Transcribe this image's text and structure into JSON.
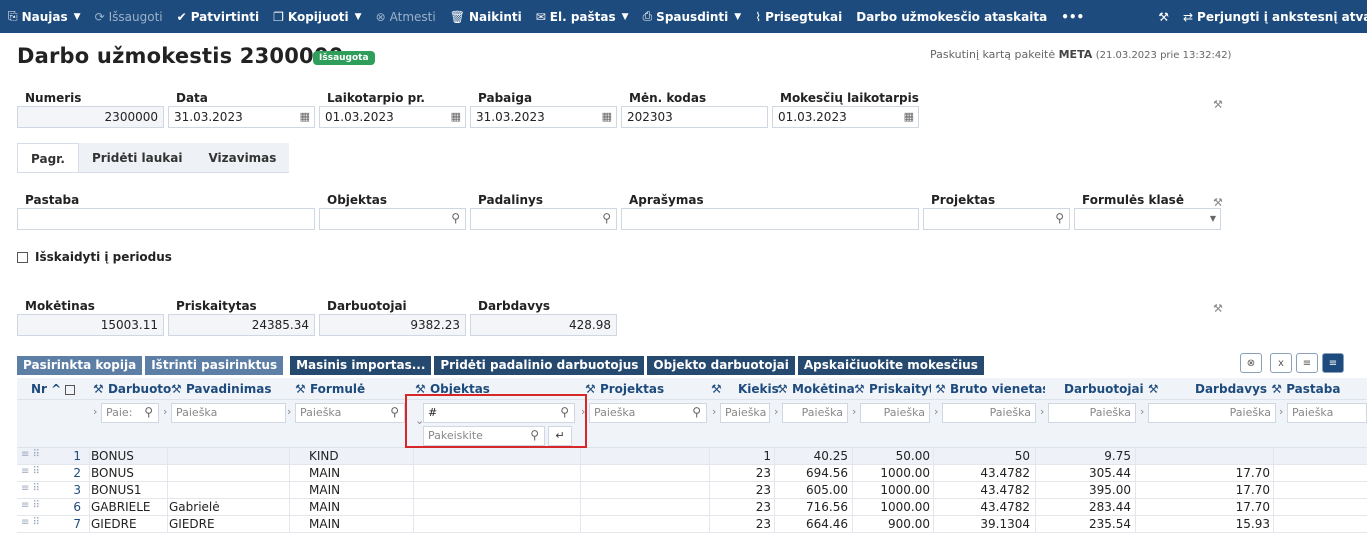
{
  "toolbar": {
    "items": [
      {
        "icon": "new-doc-icon",
        "label": "Naujas",
        "caret": true,
        "dim": false
      },
      {
        "icon": "save-icon",
        "label": "Išsaugoti",
        "caret": false,
        "dim": true
      },
      {
        "icon": "check-icon",
        "label": "Patvirtinti",
        "caret": false,
        "dim": false
      },
      {
        "icon": "copy-icon",
        "label": "Kopijuoti",
        "caret": true,
        "dim": false
      },
      {
        "icon": "cancel-icon",
        "label": "Atmesti",
        "caret": false,
        "dim": true
      },
      {
        "icon": "trash-icon",
        "label": "Naikinti",
        "caret": false,
        "dim": false
      },
      {
        "icon": "mail-icon",
        "label": "El. paštas",
        "caret": true,
        "dim": false
      },
      {
        "icon": "print-icon",
        "label": "Spausdinti",
        "caret": true,
        "dim": false
      },
      {
        "icon": "paperclip-icon",
        "label": "Prisegtukai",
        "caret": false,
        "dim": false
      },
      {
        "icon": "",
        "label": "Darbo užmokesčio ataskaita",
        "caret": false,
        "dim": false
      },
      {
        "icon": "",
        "label": "•••",
        "caret": false,
        "dim": false
      }
    ],
    "switch_label": "Perjungti į ankstesnį atvaizdavimą"
  },
  "header": {
    "title": "Darbo užmokestis 2300000",
    "status": "Išsaugota",
    "last_changed_prefix": "Paskutinį kartą pakeitė",
    "last_changed_user": "META",
    "last_changed_time": "(21.03.2023 prie 13:32:42)"
  },
  "fields": {
    "numeris_label": "Numeris",
    "numeris": "2300000",
    "data_label": "Data",
    "data": "31.03.2023",
    "laikotarpio_label": "Laikotarpio pr.",
    "laikotarpio": "01.03.2023",
    "pabaiga_label": "Pabaiga",
    "pabaiga": "31.03.2023",
    "men_kodas_label": "Mėn. kodas",
    "men_kodas": "202303",
    "mokesciu_label": "Mokesčių laikotarpis",
    "mokesciu": "01.03.2023"
  },
  "tabs": [
    "Pagr.",
    "Pridėti laukai",
    "Vizavimas"
  ],
  "form": {
    "pastaba_label": "Pastaba",
    "objektas_label": "Objektas",
    "padalinys_label": "Padalinys",
    "aprasymas_label": "Aprašymas",
    "projektas_label": "Projektas",
    "formules_label": "Formulės klasė",
    "periodai_label": "Išskaidyti į periodus"
  },
  "totals": {
    "moketinas_label": "Mokėtinas",
    "moketinas": "15003.11",
    "priskaitytas_label": "Priskaitytas",
    "priskaitytas": "24385.34",
    "darbuotojai_label": "Darbuotojai",
    "darbuotojai": "9382.23",
    "darbdavys_label": "Darbdavys",
    "darbdavys": "428.98"
  },
  "actions": {
    "pasirinkta": "Pasirinkta kopija",
    "istrinti": "Ištrinti pasirinktus",
    "masinis": "Masinis importas...",
    "prideti": "Pridėti padalinio darbuotojus",
    "objekto": "Objekto darbuotojai",
    "apskaiciuokite": "Apskaičiuokite mokesčius"
  },
  "grid": {
    "columns": {
      "nr": "Nr",
      "darbuotojas": "Darbuotoj",
      "pavadinimas": "Pavadinimas",
      "formule": "Formulė",
      "objektas": "Objektas",
      "projektas": "Projektas",
      "kiekis": "Kiekis",
      "moketina": "Mokėtina",
      "priskaityta": "Priskaityta",
      "bruto": "Bruto vienetas",
      "darbuotojai": "Darbuotojai",
      "darbdavys": "Darbdavys",
      "pastaba": "Pastaba"
    },
    "search_placeholder": "Paieška",
    "search_short": "Paie:",
    "objektas_filter": "#",
    "replace_placeholder": "Pakeiskite",
    "rows": [
      {
        "nr": "1",
        "darbuotojas": "BONUS",
        "pavadinimas": "",
        "formule": "KIND",
        "kiekis": "1",
        "moketina": "40.25",
        "priskaityta": "50.00",
        "bruto": "50",
        "darbuotojai": "9.75",
        "darbdavys": ""
      },
      {
        "nr": "2",
        "darbuotojas": "BONUS",
        "pavadinimas": "",
        "formule": "MAIN",
        "kiekis": "23",
        "moketina": "694.56",
        "priskaityta": "1000.00",
        "bruto": "43.4782",
        "darbuotojai": "305.44",
        "darbdavys": "17.70"
      },
      {
        "nr": "3",
        "darbuotojas": "BONUS1",
        "pavadinimas": "",
        "formule": "MAIN",
        "kiekis": "23",
        "moketina": "605.00",
        "priskaityta": "1000.00",
        "bruto": "43.4782",
        "darbuotojai": "395.00",
        "darbdavys": "17.70"
      },
      {
        "nr": "6",
        "darbuotojas": "GABRIELE",
        "pavadinimas": "Gabrielė",
        "formule": "MAIN",
        "kiekis": "23",
        "moketina": "716.56",
        "priskaityta": "1000.00",
        "bruto": "43.4782",
        "darbuotojai": "283.44",
        "darbdavys": "17.70"
      },
      {
        "nr": "7",
        "darbuotojas": "GIEDRE",
        "pavadinimas": "GIEDRE",
        "formule": "MAIN",
        "kiekis": "23",
        "moketina": "664.46",
        "priskaityta": "900.00",
        "bruto": "39.1304",
        "darbuotojai": "235.54",
        "darbdavys": "15.93"
      }
    ]
  }
}
